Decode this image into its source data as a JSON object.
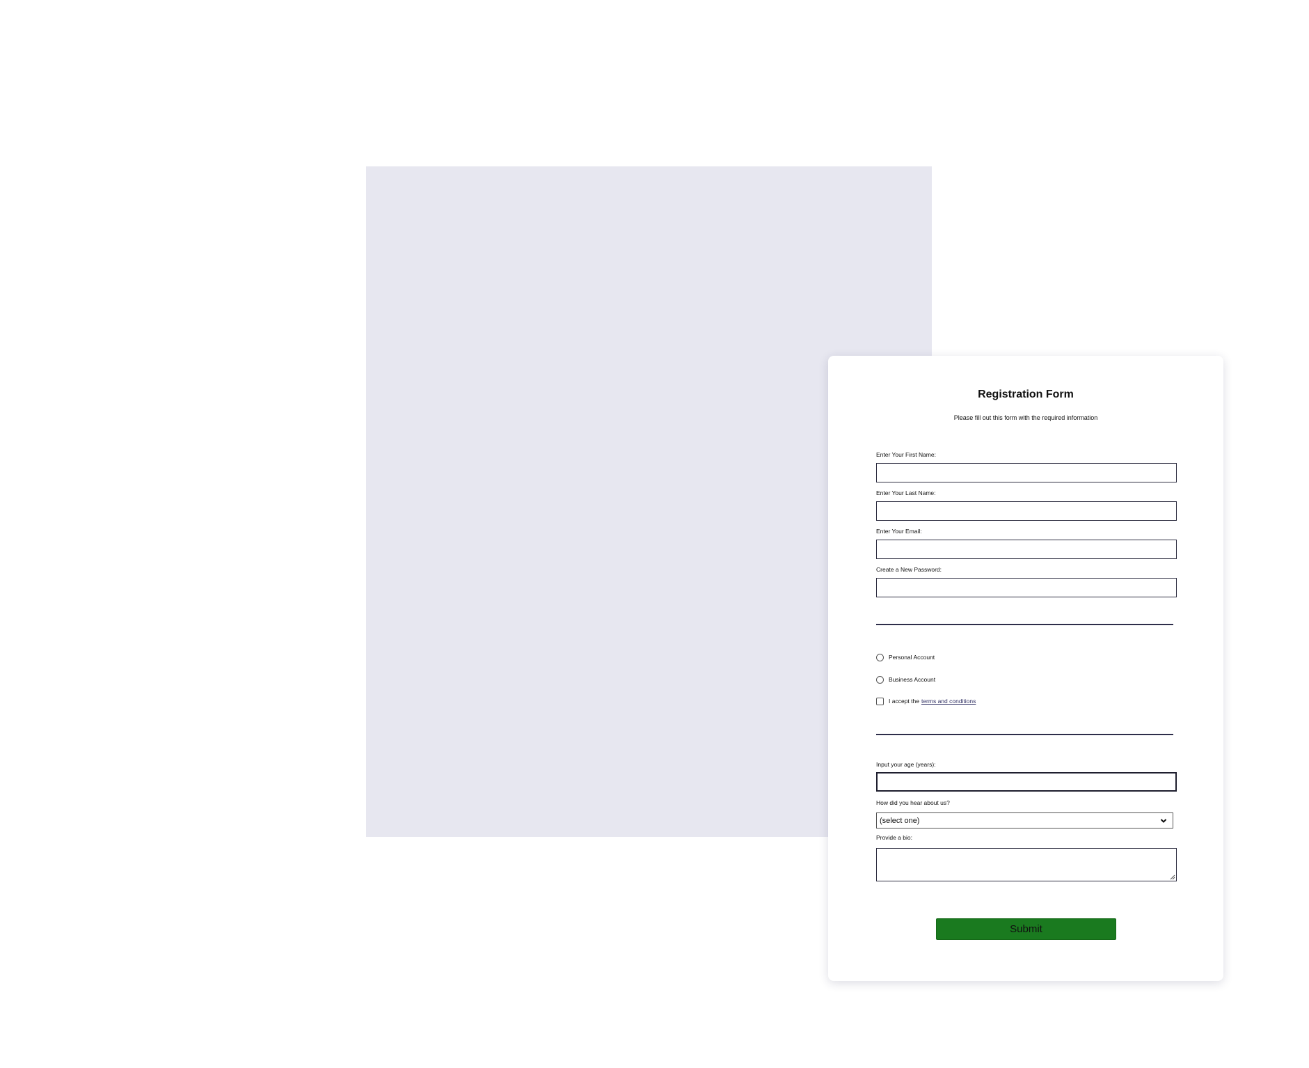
{
  "form": {
    "title": "Registration Form",
    "subtitle": "Please fill out this form with the required information",
    "fields": {
      "first_name": {
        "label": "Enter Your First Name:",
        "value": ""
      },
      "last_name": {
        "label": "Enter Your Last Name:",
        "value": ""
      },
      "email": {
        "label": "Enter Your Email:",
        "value": ""
      },
      "password": {
        "label": "Create a New Password:",
        "value": ""
      },
      "age": {
        "label": "Input your age (years):",
        "value": ""
      },
      "referral": {
        "label": "How did you hear about us?",
        "selected": "(select one)"
      },
      "bio": {
        "label": "Provide a bio:",
        "value": ""
      }
    },
    "account_types": {
      "personal": "Personal Account",
      "business": "Business Account"
    },
    "terms": {
      "prefix": "I accept the",
      "link_text": "terms and conditions"
    },
    "submit_label": "Submit"
  },
  "colors": {
    "page_background": "#ffffff",
    "backdrop": "#e7e7f0",
    "card": "#ffffff",
    "submit_button": "#1a7a1f",
    "divider": "#2e2e4a",
    "input_border": "#2d2d40"
  },
  "icons": {
    "select_arrow": "chevron-down-icon",
    "textarea_resize": "resize-grip-icon"
  }
}
